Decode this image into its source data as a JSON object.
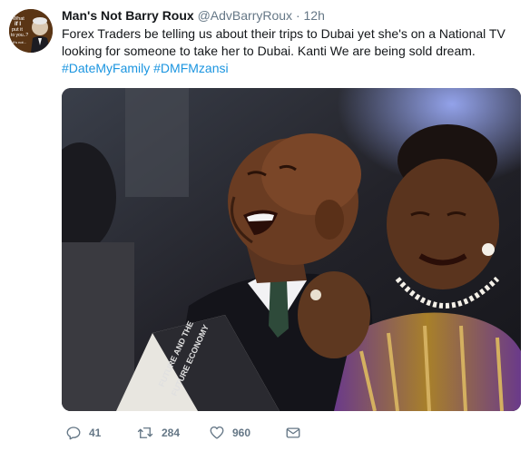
{
  "tweet": {
    "display_name": "Man's Not Barry Roux",
    "handle": "@AdvBarryRoux",
    "separator": "·",
    "time": "12h",
    "text_line1": "Forex Traders be telling us about their trips to Dubai yet she's on a National TV",
    "text_line2": "looking for someone to take her to Dubai. Kanti We are being sold dream.",
    "hashtags": [
      "#DateMyFamily",
      "#DMFMzansi"
    ],
    "avatar_text": [
      "What",
      "if I",
      "put it",
      "to you..?",
      "It's not..."
    ]
  },
  "media": {
    "book_text": [
      "FUTURE AND THE",
      "FUTURE ECONOMY"
    ]
  },
  "actions": {
    "reply_count": "41",
    "retweet_count": "284",
    "like_count": "960"
  },
  "colors": {
    "text": "#14171a",
    "secondary": "#657786",
    "link": "#1b95e0"
  },
  "icons": {
    "reply": "reply-icon",
    "retweet": "retweet-icon",
    "like": "heart-icon",
    "dm": "envelope-icon"
  }
}
